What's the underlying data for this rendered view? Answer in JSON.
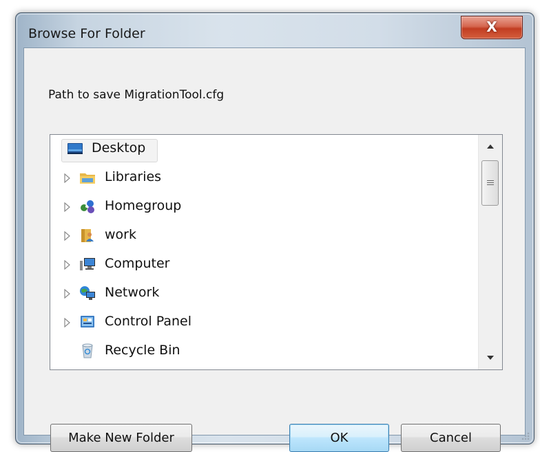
{
  "window": {
    "title": "Browse For Folder",
    "close_glyph": "X"
  },
  "dialog": {
    "description": "Path to save MigrationTool.cfg"
  },
  "tree": {
    "items": [
      {
        "label": "Desktop",
        "icon": "desktop-icon",
        "expandable": false,
        "selected": true
      },
      {
        "label": "Libraries",
        "icon": "libraries-icon",
        "expandable": true,
        "selected": false
      },
      {
        "label": "Homegroup",
        "icon": "homegroup-icon",
        "expandable": true,
        "selected": false
      },
      {
        "label": "work",
        "icon": "user-folder-icon",
        "expandable": true,
        "selected": false
      },
      {
        "label": "Computer",
        "icon": "computer-icon",
        "expandable": true,
        "selected": false
      },
      {
        "label": "Network",
        "icon": "network-icon",
        "expandable": true,
        "selected": false
      },
      {
        "label": "Control Panel",
        "icon": "control-panel-icon",
        "expandable": true,
        "selected": false
      },
      {
        "label": "Recycle Bin",
        "icon": "recycle-bin-icon",
        "expandable": false,
        "selected": false
      }
    ],
    "scroll_fraction_visible": 0.25
  },
  "buttons": {
    "make_new_folder": "Make New Folder",
    "ok": "OK",
    "cancel": "Cancel"
  }
}
